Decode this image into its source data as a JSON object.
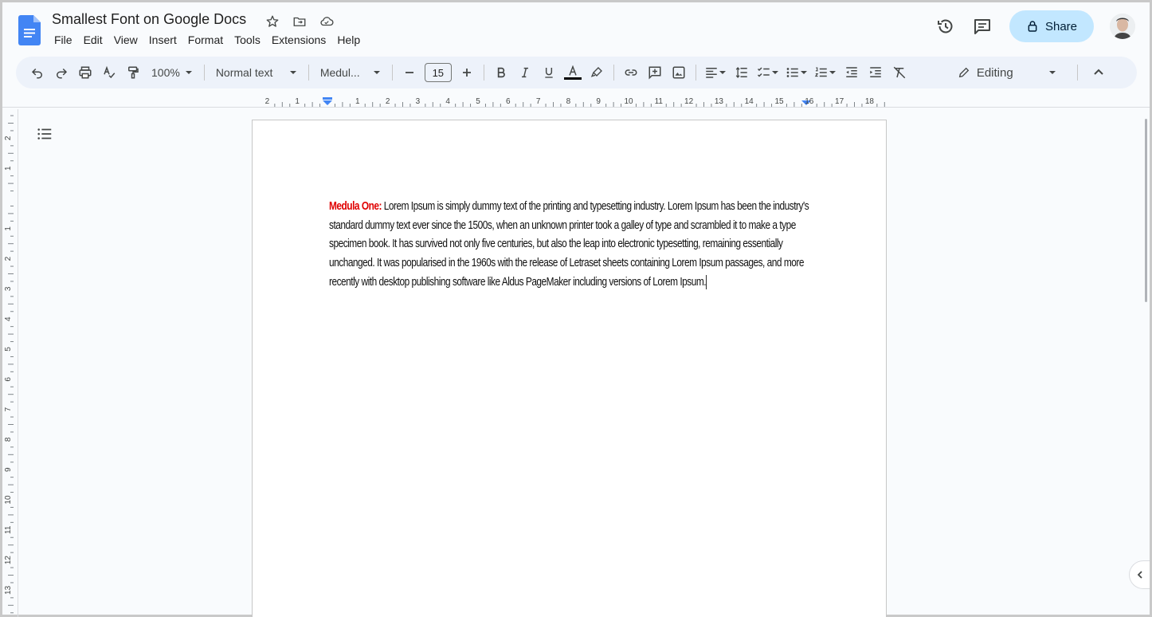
{
  "doc": {
    "title": "Smallest Font on Google Docs"
  },
  "menu": [
    "File",
    "Edit",
    "View",
    "Insert",
    "Format",
    "Tools",
    "Extensions",
    "Help"
  ],
  "header": {
    "share_label": "Share"
  },
  "toolbar": {
    "zoom": "100%",
    "style": "Normal text",
    "font": "Medul...",
    "font_size": "15",
    "mode": "Editing"
  },
  "content": {
    "label": "Medula One:",
    "body": " Lorem Ipsum is simply dummy text of the printing and typesetting industry. Lorem Ipsum has been the industry's standard dummy text ever since the 1500s, when an unknown printer took a galley of type and scrambled it to make a type specimen book. It has survived not only five centuries, but also the leap into electronic typesetting, remaining essentially unchanged. It was popularised in the 1960s with the release of Letraset sheets containing Lorem Ipsum passages, and more recently with desktop publishing software like Aldus PageMaker including versions of Lorem Ipsum."
  },
  "ruler": {
    "h_labels": [
      "2",
      "1",
      "1",
      "2",
      "3",
      "4",
      "5",
      "6",
      "7",
      "8",
      "9",
      "10",
      "11",
      "12",
      "13",
      "14",
      "15",
      "16",
      "17",
      "18"
    ],
    "v_labels": [
      "2",
      "1",
      "1",
      "2",
      "3",
      "4",
      "5",
      "6",
      "7",
      "8",
      "9",
      "10",
      "11",
      "12",
      "13"
    ]
  },
  "colors": {
    "accent": "#c2e7ff",
    "label_red": "#e00000",
    "text_color_bar": "#000000"
  },
  "icons": [
    "docs-logo-icon",
    "star-icon",
    "move-folder-icon",
    "cloud-status-icon",
    "history-icon",
    "comments-icon",
    "lock-icon",
    "undo-icon",
    "redo-icon",
    "print-icon",
    "spellcheck-icon",
    "paint-format-icon",
    "bold-icon",
    "italic-icon",
    "underline-icon",
    "text-color-icon",
    "highlight-icon",
    "link-icon",
    "add-comment-icon",
    "insert-image-icon",
    "align-icon",
    "line-spacing-icon",
    "checklist-icon",
    "bullet-list-icon",
    "numbered-list-icon",
    "decrease-indent-icon",
    "increase-indent-icon",
    "clear-formatting-icon",
    "pencil-icon",
    "collapse-icon",
    "outline-icon"
  ]
}
